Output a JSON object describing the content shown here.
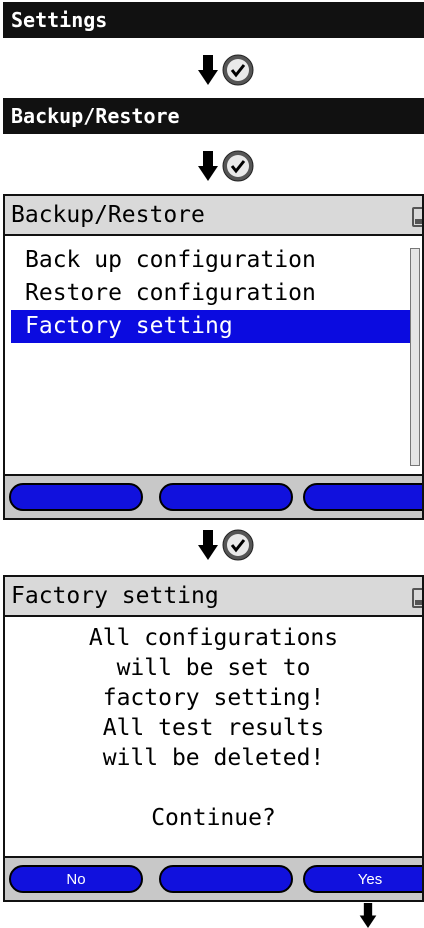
{
  "bars": {
    "settings": "Settings",
    "backup_restore": "Backup/Restore"
  },
  "icons": {
    "arrow": "arrow-down-icon",
    "ok": "ok-check-icon",
    "battery": "battery-icon"
  },
  "screen1": {
    "title": "Backup/Restore",
    "items": [
      "Back up configuration",
      "Restore configuration",
      "Factory setting"
    ],
    "selected_index": 2,
    "softkeys": [
      "",
      "",
      ""
    ]
  },
  "screen2": {
    "title": "Factory setting",
    "lines": [
      "All configurations",
      "will be set to",
      "factory setting!",
      "All test results",
      "will be deleted!",
      "",
      "Continue?"
    ],
    "softkeys": [
      "No",
      "",
      "Yes"
    ]
  },
  "colors": {
    "title_bar": "#111111",
    "selection": "#0b0be0",
    "softkey": "#1111dd"
  }
}
